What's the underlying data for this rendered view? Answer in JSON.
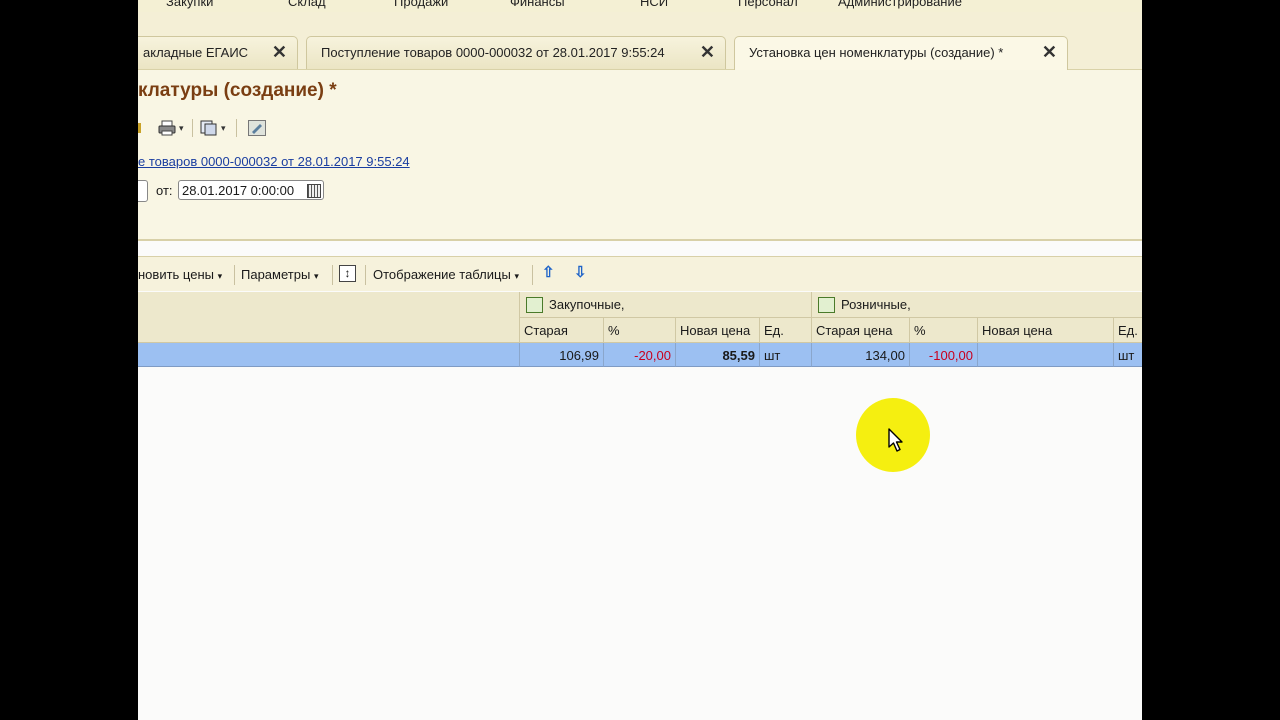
{
  "menu": [
    "Закупки",
    "Склад",
    "Продажи",
    "Финансы",
    "НСИ",
    "Персонал",
    "Администрирование"
  ],
  "tabs": [
    {
      "label": "акладные ЕГАИС"
    },
    {
      "label": "Поступление товаров 0000-000032 от 28.01.2017 9:55:24"
    },
    {
      "label": "Установка цен номенклатуры (создание) *"
    }
  ],
  "tab_close_glyph": "✕",
  "form": {
    "title": "клатуры (создание) *",
    "basis_link": "е товаров 0000-000032 от 28.01.2017 9:55:24",
    "date_label": "от:",
    "date_value": "28.01.2017  0:00:00"
  },
  "table_toolbar": {
    "update_prices": "новить цены",
    "parameters": "Параметры",
    "table_display": "Отображение таблицы",
    "dropdown_glyph": "▾",
    "up_glyph": "⇧",
    "down_glyph": "⇩",
    "updown_glyph": "↕"
  },
  "grid": {
    "groups": [
      "Закупочные,",
      "Розничные,"
    ],
    "columns": [
      "Старая",
      "%",
      "Новая цена",
      "Ед.",
      "Старая цена",
      "%",
      "Новая цена",
      "Ед."
    ],
    "row": {
      "purchase_old": "106,99",
      "purchase_pct": "-20,00",
      "purchase_new": "85,59",
      "purchase_unit": "шт",
      "retail_old": "134,00",
      "retail_pct": "-100,00",
      "retail_new": "",
      "retail_unit": "шт"
    }
  },
  "colors": {
    "title": "#7a3e12",
    "negative": "#c8001e",
    "selected_row": "#9cc0f2",
    "cursor_highlight": "#f5ef10"
  },
  "icons": [
    "print-icon",
    "copy-icon",
    "edit-icon",
    "calendar-icon",
    "purchase-group-icon",
    "retail-group-icon",
    "arrow-up-icon",
    "arrow-down-icon",
    "mouse-pointer-icon"
  ]
}
